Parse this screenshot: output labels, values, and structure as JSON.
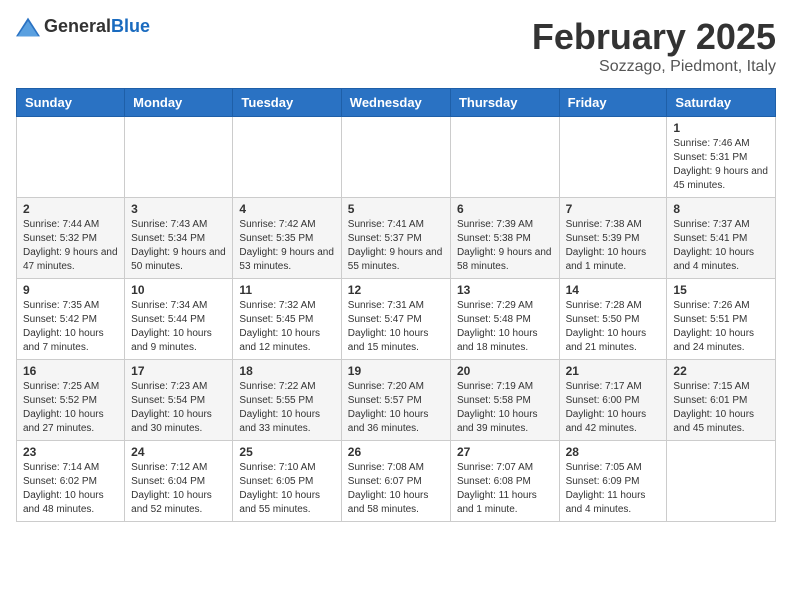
{
  "header": {
    "logo": {
      "general": "General",
      "blue": "Blue"
    },
    "title": "February 2025",
    "subtitle": "Sozzago, Piedmont, Italy"
  },
  "weekdays": [
    "Sunday",
    "Monday",
    "Tuesday",
    "Wednesday",
    "Thursday",
    "Friday",
    "Saturday"
  ],
  "weeks": [
    [
      {
        "day": "",
        "info": ""
      },
      {
        "day": "",
        "info": ""
      },
      {
        "day": "",
        "info": ""
      },
      {
        "day": "",
        "info": ""
      },
      {
        "day": "",
        "info": ""
      },
      {
        "day": "",
        "info": ""
      },
      {
        "day": "1",
        "info": "Sunrise: 7:46 AM\nSunset: 5:31 PM\nDaylight: 9 hours and 45 minutes."
      }
    ],
    [
      {
        "day": "2",
        "info": "Sunrise: 7:44 AM\nSunset: 5:32 PM\nDaylight: 9 hours and 47 minutes."
      },
      {
        "day": "3",
        "info": "Sunrise: 7:43 AM\nSunset: 5:34 PM\nDaylight: 9 hours and 50 minutes."
      },
      {
        "day": "4",
        "info": "Sunrise: 7:42 AM\nSunset: 5:35 PM\nDaylight: 9 hours and 53 minutes."
      },
      {
        "day": "5",
        "info": "Sunrise: 7:41 AM\nSunset: 5:37 PM\nDaylight: 9 hours and 55 minutes."
      },
      {
        "day": "6",
        "info": "Sunrise: 7:39 AM\nSunset: 5:38 PM\nDaylight: 9 hours and 58 minutes."
      },
      {
        "day": "7",
        "info": "Sunrise: 7:38 AM\nSunset: 5:39 PM\nDaylight: 10 hours and 1 minute."
      },
      {
        "day": "8",
        "info": "Sunrise: 7:37 AM\nSunset: 5:41 PM\nDaylight: 10 hours and 4 minutes."
      }
    ],
    [
      {
        "day": "9",
        "info": "Sunrise: 7:35 AM\nSunset: 5:42 PM\nDaylight: 10 hours and 7 minutes."
      },
      {
        "day": "10",
        "info": "Sunrise: 7:34 AM\nSunset: 5:44 PM\nDaylight: 10 hours and 9 minutes."
      },
      {
        "day": "11",
        "info": "Sunrise: 7:32 AM\nSunset: 5:45 PM\nDaylight: 10 hours and 12 minutes."
      },
      {
        "day": "12",
        "info": "Sunrise: 7:31 AM\nSunset: 5:47 PM\nDaylight: 10 hours and 15 minutes."
      },
      {
        "day": "13",
        "info": "Sunrise: 7:29 AM\nSunset: 5:48 PM\nDaylight: 10 hours and 18 minutes."
      },
      {
        "day": "14",
        "info": "Sunrise: 7:28 AM\nSunset: 5:50 PM\nDaylight: 10 hours and 21 minutes."
      },
      {
        "day": "15",
        "info": "Sunrise: 7:26 AM\nSunset: 5:51 PM\nDaylight: 10 hours and 24 minutes."
      }
    ],
    [
      {
        "day": "16",
        "info": "Sunrise: 7:25 AM\nSunset: 5:52 PM\nDaylight: 10 hours and 27 minutes."
      },
      {
        "day": "17",
        "info": "Sunrise: 7:23 AM\nSunset: 5:54 PM\nDaylight: 10 hours and 30 minutes."
      },
      {
        "day": "18",
        "info": "Sunrise: 7:22 AM\nSunset: 5:55 PM\nDaylight: 10 hours and 33 minutes."
      },
      {
        "day": "19",
        "info": "Sunrise: 7:20 AM\nSunset: 5:57 PM\nDaylight: 10 hours and 36 minutes."
      },
      {
        "day": "20",
        "info": "Sunrise: 7:19 AM\nSunset: 5:58 PM\nDaylight: 10 hours and 39 minutes."
      },
      {
        "day": "21",
        "info": "Sunrise: 7:17 AM\nSunset: 6:00 PM\nDaylight: 10 hours and 42 minutes."
      },
      {
        "day": "22",
        "info": "Sunrise: 7:15 AM\nSunset: 6:01 PM\nDaylight: 10 hours and 45 minutes."
      }
    ],
    [
      {
        "day": "23",
        "info": "Sunrise: 7:14 AM\nSunset: 6:02 PM\nDaylight: 10 hours and 48 minutes."
      },
      {
        "day": "24",
        "info": "Sunrise: 7:12 AM\nSunset: 6:04 PM\nDaylight: 10 hours and 52 minutes."
      },
      {
        "day": "25",
        "info": "Sunrise: 7:10 AM\nSunset: 6:05 PM\nDaylight: 10 hours and 55 minutes."
      },
      {
        "day": "26",
        "info": "Sunrise: 7:08 AM\nSunset: 6:07 PM\nDaylight: 10 hours and 58 minutes."
      },
      {
        "day": "27",
        "info": "Sunrise: 7:07 AM\nSunset: 6:08 PM\nDaylight: 11 hours and 1 minute."
      },
      {
        "day": "28",
        "info": "Sunrise: 7:05 AM\nSunset: 6:09 PM\nDaylight: 11 hours and 4 minutes."
      },
      {
        "day": "",
        "info": ""
      }
    ]
  ]
}
